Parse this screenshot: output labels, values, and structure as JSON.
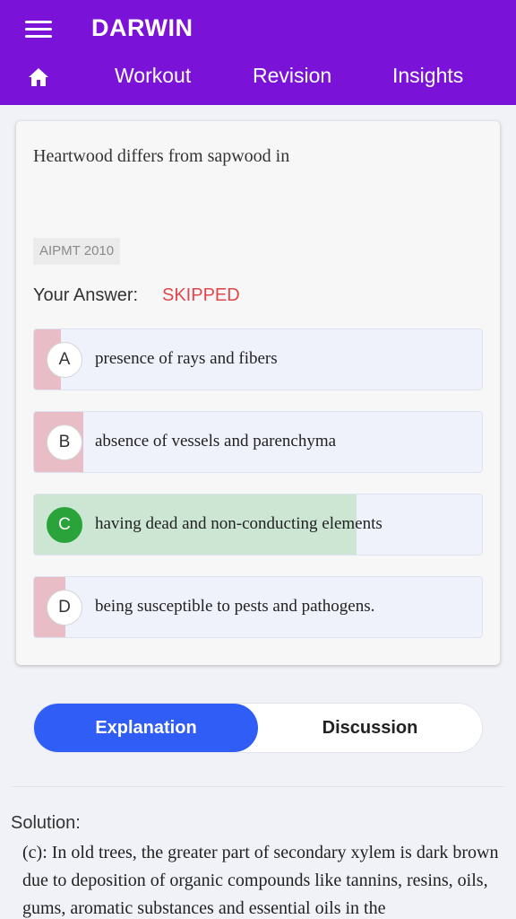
{
  "app": {
    "title": "DARWIN"
  },
  "nav": {
    "tabs": [
      "Workout",
      "Revision",
      "Insights"
    ]
  },
  "question": {
    "text": "Heartwood differs from sapwood in",
    "tag": "AIPMT 2010",
    "your_answer_label": "Your Answer:",
    "your_answer_value": "SKIPPED",
    "options": [
      {
        "letter": "A",
        "text": "presence of rays and fibers",
        "response_share": 0.06,
        "correct": false
      },
      {
        "letter": "B",
        "text": "absence of vessels and parenchyma",
        "response_share": 0.11,
        "correct": false
      },
      {
        "letter": "C",
        "text": "having dead and non-conducting elements",
        "response_share": 0.72,
        "correct": true
      },
      {
        "letter": "D",
        "text": "being susceptible to pests and pathogens.",
        "response_share": 0.07,
        "correct": false
      }
    ]
  },
  "segment": {
    "explanation": "Explanation",
    "discussion": "Discussion"
  },
  "solution": {
    "title": "Solution:",
    "text": "(c): In old trees, the greater part of secondary xylem is dark brown due to deposition of organic compounds like tannins, resins, oils, gums, aromatic substances and essential oils in the"
  },
  "colors": {
    "appbar": "#7a12d8",
    "wrong_fill": "#e8bdc6",
    "correct_fill": "#cce6d3",
    "correct_circle": "#29a33a",
    "skipped": "#e0474c",
    "accent": "#2f5df5"
  }
}
